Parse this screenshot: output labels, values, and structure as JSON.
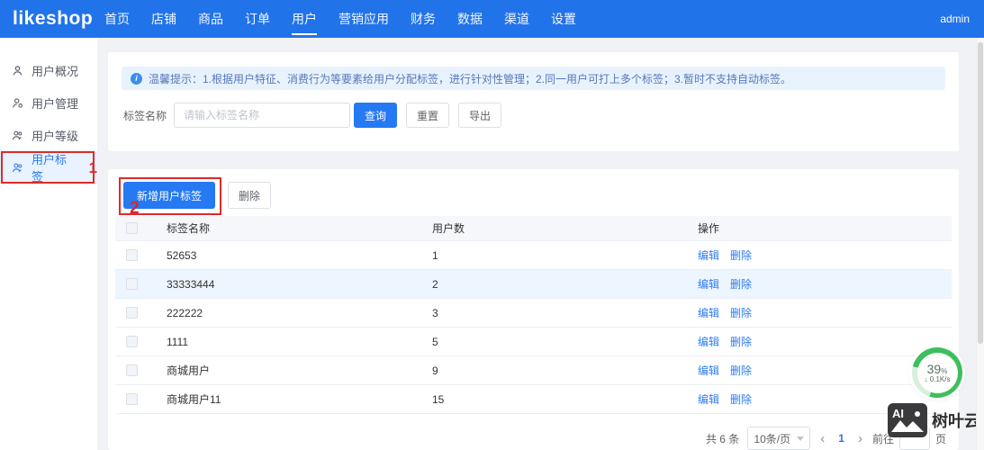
{
  "navbar": {
    "logo": "likeshop",
    "items": [
      {
        "label": "首页"
      },
      {
        "label": "店铺"
      },
      {
        "label": "商品"
      },
      {
        "label": "订单"
      },
      {
        "label": "用户",
        "active": true
      },
      {
        "label": "营销应用"
      },
      {
        "label": "财务"
      },
      {
        "label": "数据"
      },
      {
        "label": "渠道"
      },
      {
        "label": "设置"
      }
    ],
    "user": "admin"
  },
  "sidebar": {
    "items": [
      {
        "label": "用户概况"
      },
      {
        "label": "用户管理"
      },
      {
        "label": "用户等级"
      },
      {
        "label": "用户标签",
        "active": true
      }
    ]
  },
  "annotations": {
    "sidebar_marker": "1",
    "button_marker": "2"
  },
  "notice": {
    "text": "温馨提示：1.根据用户特征、消费行为等要素给用户分配标签，进行针对性管理；2.同一用户可打上多个标签；3.暂时不支持自动标签。"
  },
  "filter": {
    "label": "标签名称",
    "placeholder": "请输入标签名称",
    "search": "查询",
    "reset": "重置",
    "export": "导出"
  },
  "toolbar": {
    "add": "新增用户标签",
    "delete": "删除"
  },
  "table": {
    "columns": {
      "name": "标签名称",
      "count": "用户数",
      "actions": "操作"
    },
    "row_actions": {
      "edit": "编辑",
      "delete": "删除"
    },
    "rows": [
      {
        "name": "52653",
        "count": "1"
      },
      {
        "name": "33333444",
        "count": "2"
      },
      {
        "name": "222222",
        "count": "3"
      },
      {
        "name": "1111",
        "count": "5"
      },
      {
        "name": "商城用户",
        "count": "9"
      },
      {
        "name": "商城用户11",
        "count": "15"
      }
    ]
  },
  "pagination": {
    "total": "共 6 条",
    "page_size": "10条/页",
    "prev": "‹",
    "page": "1",
    "next": "›",
    "goto_label": "前往",
    "goto_suffix": "页"
  },
  "speed_widget": {
    "percent": "39",
    "unit": "%",
    "arrow": "↓",
    "speed": "0.1K/s"
  },
  "watermark": {
    "logo": "AI",
    "brand": "树叶云"
  },
  "icons": {
    "info": "i"
  },
  "colors": {
    "navbar": "#2173ea",
    "primary": "#2579f2",
    "link": "#2e7cf0",
    "annotation": "#e02a2a",
    "notice_bg": "#e8f2fd",
    "widget_ring": "#3dc05c"
  }
}
